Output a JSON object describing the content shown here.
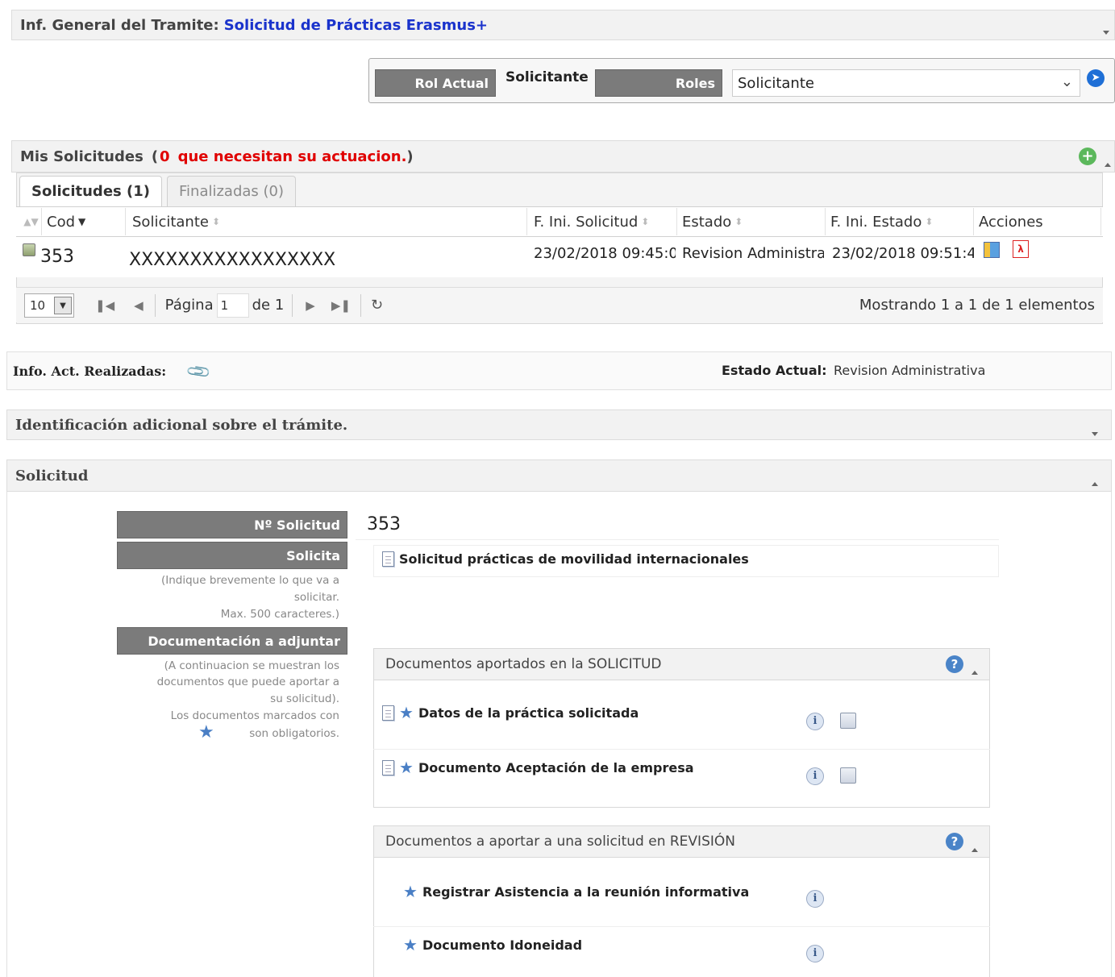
{
  "tramite": {
    "label": "Inf. General del Tramite:",
    "name": "Solicitud de Prácticas Erasmus+"
  },
  "roles": {
    "rol_actual_label": "Rol Actual",
    "rol_actual_value": "Solicitante",
    "roles_label": "Roles",
    "roles_selected": "Solicitante"
  },
  "mis_solicitudes": {
    "title": "Mis Solicitudes",
    "paren_open": "(",
    "count": "0",
    "count_text": "que necesitan su actuacion.",
    "paren_close": ")",
    "tabs": [
      {
        "label": "Solicitudes (1)"
      },
      {
        "label": "Finalizadas (0)"
      }
    ],
    "columns": [
      "Cod",
      "Solicitante",
      "F. Ini. Solicitud",
      "Estado",
      "F. Ini. Estado",
      "Acciones"
    ],
    "rows": [
      {
        "cod": "353",
        "solicitante": "XXXXXXXXXXXXXXXXX",
        "f_ini_solicitud": "23/02/2018 09:45:0",
        "estado": "Revision Administrativa",
        "f_ini_estado": "23/02/2018 09:51:4"
      }
    ],
    "pager": {
      "page_size": "10",
      "pagina_label": "Página",
      "page": "1",
      "de_label": "de 1",
      "summary": "Mostrando 1 a 1 de 1 elementos"
    }
  },
  "info_act": {
    "label": "Info. Act. Realizadas:",
    "estado_label": "Estado Actual:",
    "estado_value": "Revision Administrativa"
  },
  "identificacion": {
    "title": "Identificación adicional sobre el trámite."
  },
  "solicitud": {
    "title": "Solicitud",
    "num_label": "Nº Solicitud",
    "num_value": "353",
    "solicita_label": "Solicita",
    "solicita_value": "Solicitud prácticas de movilidad internacionales",
    "solicita_note_1": "(Indique brevemente lo que va a",
    "solicita_note_2": "solicitar.",
    "solicita_note_3": "Max. 500 caracteres.)",
    "doc_label": "Documentación a adjuntar",
    "doc_note_1": "(A continuacion se muestran los",
    "doc_note_2": "documentos que puede aportar a",
    "doc_note_3": "su solicitud).",
    "doc_note_4": "Los documentos marcados con",
    "doc_note_5": "son obligatorios."
  },
  "docs_aportados": {
    "title": "Documentos aportados en la SOLICITUD",
    "items": [
      {
        "label": "Datos de la práctica solicitada"
      },
      {
        "label": "Documento Aceptación de la empresa"
      }
    ]
  },
  "docs_revision": {
    "title": "Documentos a aportar a una solicitud en REVISIÓN",
    "items": [
      {
        "label": "Registrar Asistencia a la reunión informativa"
      },
      {
        "label": "Documento Idoneidad"
      }
    ]
  },
  "colors": {
    "link_blue": "#1a33cc",
    "alert_red": "#e00000",
    "label_gray": "#7b7b7b"
  }
}
